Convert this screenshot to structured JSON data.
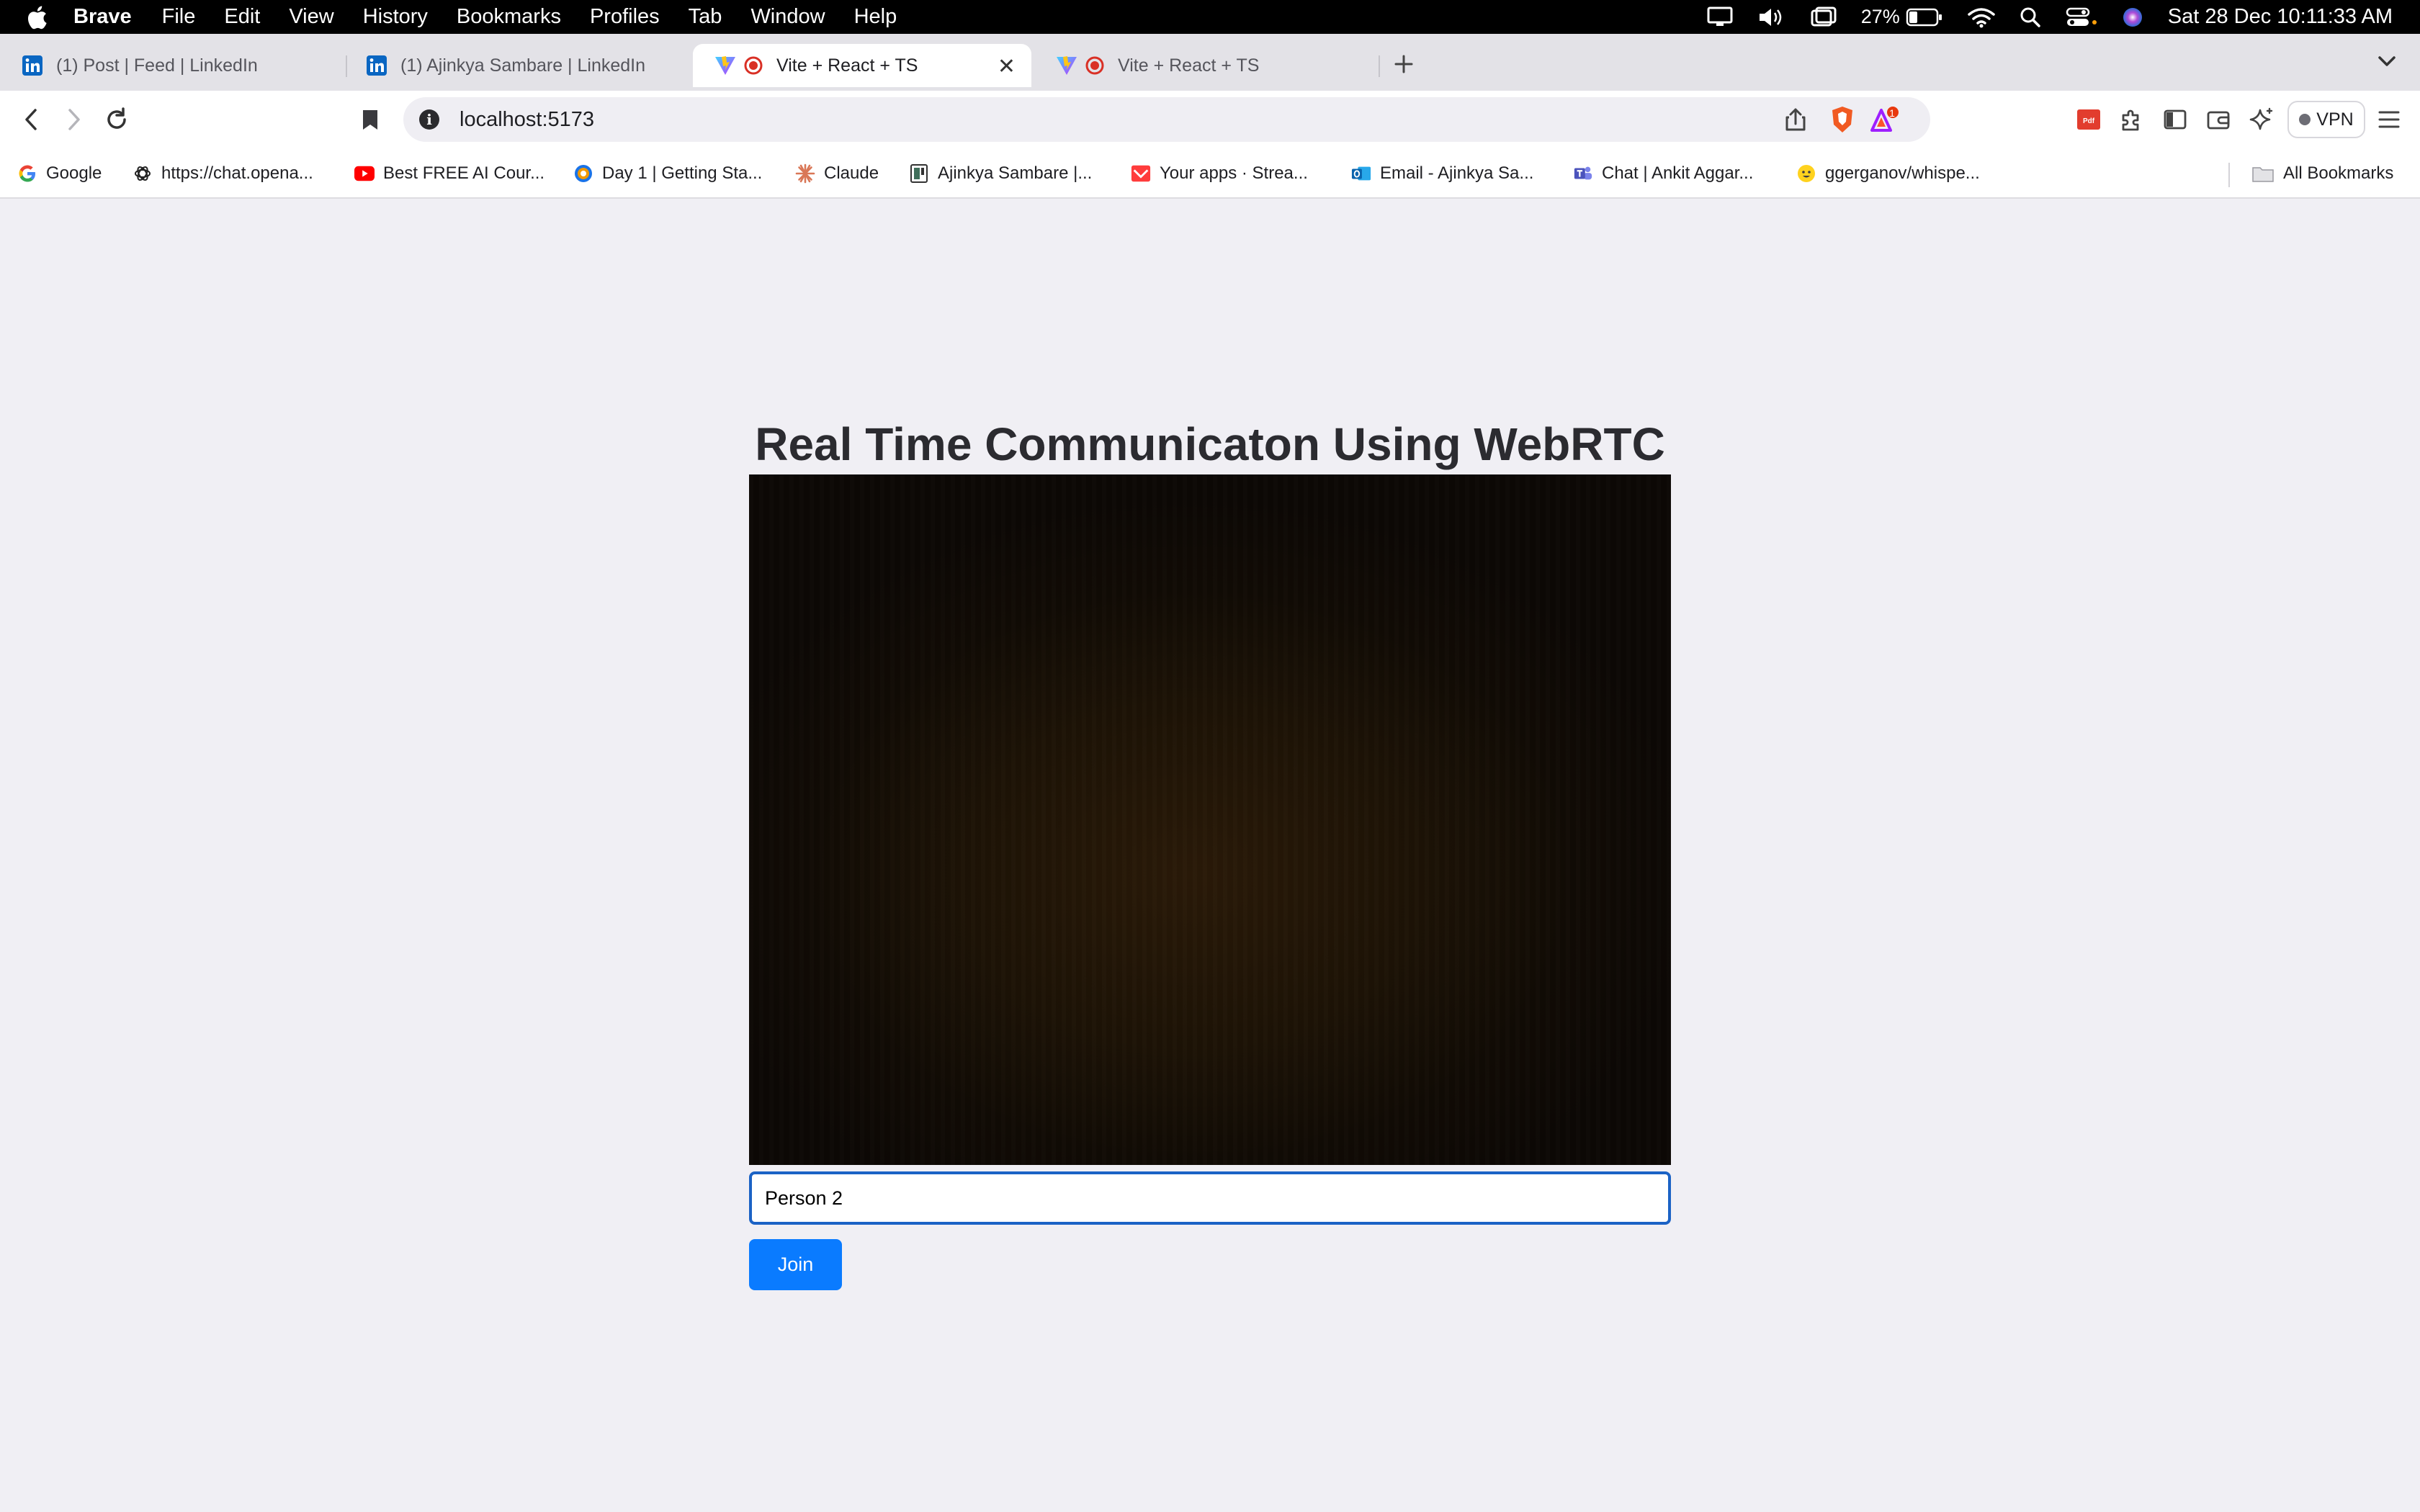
{
  "menubar": {
    "app_name": "Brave",
    "items": [
      "File",
      "Edit",
      "View",
      "History",
      "Bookmarks",
      "Profiles",
      "Tab",
      "Window",
      "Help"
    ],
    "battery": "27%",
    "datetime": "Sat 28 Dec  10:11:33 AM"
  },
  "tabs": [
    {
      "title": "(1) Post | Feed | LinkedIn",
      "active": false,
      "icon": "linkedin-icon"
    },
    {
      "title": "(1) Ajinkya Sambare | LinkedIn",
      "active": false,
      "icon": "linkedin-icon"
    },
    {
      "title": "Vite + React + TS",
      "active": true,
      "icon": "vite-icon",
      "recording": true
    },
    {
      "title": "Vite + React + TS",
      "active": false,
      "icon": "vite-icon",
      "recording": true
    }
  ],
  "toolbar": {
    "url": "localhost:5173",
    "rewards_badge": "1",
    "vpn_label": "VPN"
  },
  "bookmarks": [
    {
      "label": "Google",
      "icon": "google-icon"
    },
    {
      "label": "https://chat.opena...",
      "icon": "openai-icon"
    },
    {
      "label": "Best FREE AI Cour...",
      "icon": "youtube-icon"
    },
    {
      "label": "Day 1 | Getting Sta...",
      "icon": "course-icon"
    },
    {
      "label": "Claude",
      "icon": "claude-icon"
    },
    {
      "label": "Ajinkya Sambare |...",
      "icon": "profile-icon"
    },
    {
      "label": "Your apps · Strea...",
      "icon": "streamlit-icon"
    },
    {
      "label": "Email - Ajinkya Sa...",
      "icon": "outlook-icon"
    },
    {
      "label": "Chat | Ankit Aggar...",
      "icon": "teams-icon"
    },
    {
      "label": "ggerganov/whispe...",
      "icon": "huggingface-icon"
    }
  ],
  "all_bookmarks_label": "All Bookmarks",
  "page": {
    "title": "Real Time Communicaton Using WebRTC",
    "name_input_value": "Person 2",
    "join_label": "Join"
  },
  "colors": {
    "page_background": "#f0eff4",
    "join_button": "#0a7bff",
    "input_focus_border": "#1b62c5"
  }
}
